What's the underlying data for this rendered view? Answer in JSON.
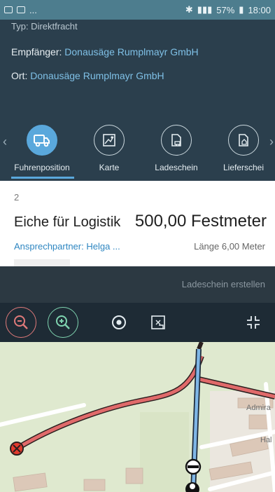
{
  "statusbar": {
    "left_text": "...",
    "battery": "57%",
    "time": "18:00"
  },
  "header": {
    "typ_line": "Typ: Direktfracht",
    "empfaenger_label": "Empfänger:",
    "empfaenger_value": "Donausäge Rumplmayr GmbH",
    "ort_label": "Ort:",
    "ort_value": "Donausäge Rumplmayr GmbH"
  },
  "nav": {
    "items": [
      {
        "label": "Fuhrenposition",
        "icon": "truck-icon",
        "active": true
      },
      {
        "label": "Karte",
        "icon": "map-icon",
        "active": false
      },
      {
        "label": "Ladeschein",
        "icon": "document-truck-icon",
        "active": false
      },
      {
        "label": "Lieferschei",
        "icon": "document-home-icon",
        "active": false
      }
    ]
  },
  "position": {
    "number": "2",
    "product": "Eiche für Logistik",
    "quantity": "500,00 Festmeter",
    "contact": "Ansprechpartner: Helga ...",
    "length": "Länge 6,00 Meter"
  },
  "overlay": {
    "action_label": "Ladeschein erstellen"
  },
  "map_toolbar": {
    "tools": [
      "zoom-out-icon",
      "zoom-in-icon",
      "locate-icon",
      "map-layers-icon",
      "collapse-icon"
    ]
  },
  "map": {
    "labels": [
      "Admira",
      "Hal"
    ]
  },
  "colors": {
    "accent": "#5aa8dc",
    "header_bg": "#2b3f4d",
    "route_red": "#e06a6a",
    "route_blue": "#7fb6e6"
  }
}
